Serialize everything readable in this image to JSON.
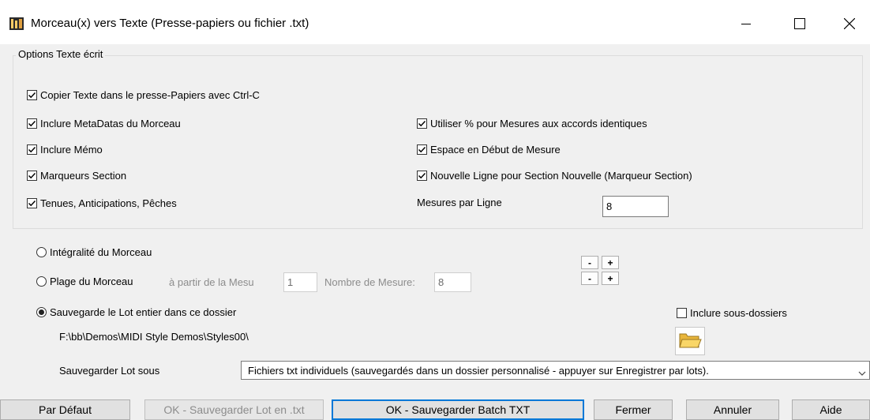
{
  "window": {
    "title": "Morceau(x) vers Texte (Presse-papiers ou fichier .txt)",
    "app_icon": "band-in-a-box-icon",
    "controls": [
      "minimize-icon",
      "maximize-icon",
      "close-icon"
    ]
  },
  "options_group": {
    "title": "Options Texte écrit",
    "copy_clipboard": {
      "label": "Copier Texte dans le presse-Papiers avec Ctrl-C",
      "checked": true
    },
    "left_checks": [
      {
        "label": "Inclure MetaDatas du Morceau",
        "checked": true
      },
      {
        "label": "Inclure Mémo",
        "checked": true
      },
      {
        "label": "Marqueurs Section",
        "checked": true
      },
      {
        "label": "Tenues, Anticipations, Pêches",
        "checked": true
      }
    ],
    "right_checks": [
      {
        "label": "Utiliser % pour Mesures aux accords identiques",
        "checked": true
      },
      {
        "label": "Espace en Début de Mesure",
        "checked": true
      },
      {
        "label": "Nouvelle Ligne pour Section Nouvelle (Marqueur Section)",
        "checked": true
      }
    ],
    "bars_per_line": {
      "label": "Mesures par Ligne",
      "value": "8"
    }
  },
  "range": {
    "whole_song": {
      "label": "Intégralité du Morceau",
      "selected": false
    },
    "song_range": {
      "label": "Plage du Morceau",
      "selected": false,
      "from_label": "à partir de la Mesu",
      "from_value": "1",
      "count_label": "Nombre de Mesure:",
      "count_value": "8"
    },
    "spinners": {
      "minus": "-",
      "plus": "+"
    },
    "batch_folder": {
      "label": "Sauvegarde le Lot entier dans ce dossier",
      "selected": true
    },
    "include_subfolders": {
      "label": "Inclure sous-dossiers",
      "checked": false
    },
    "folder_path": "F:\\bb\\Demos\\MIDI Style Demos\\Styles00\\",
    "folder_icon": "open-folder-icon",
    "save_batch_as": {
      "label": "Sauvegarder Lot sous",
      "value": "Fichiers txt individuels (sauvegardés dans un dossier personnalisé - appuyer sur Enregistrer par lots)."
    }
  },
  "buttons": {
    "default": "Par Défaut",
    "ok_batch_txt_disabled": "OK - Sauvegarder Lot en .txt",
    "ok_batch_txt": "OK - Sauvegarder Batch TXT",
    "close": "Fermer",
    "cancel": "Annuler",
    "help": "Aide"
  },
  "colors": {
    "accent": "#0078d7",
    "window_bg": "#f0f0f0",
    "folder": "#f5c842"
  }
}
